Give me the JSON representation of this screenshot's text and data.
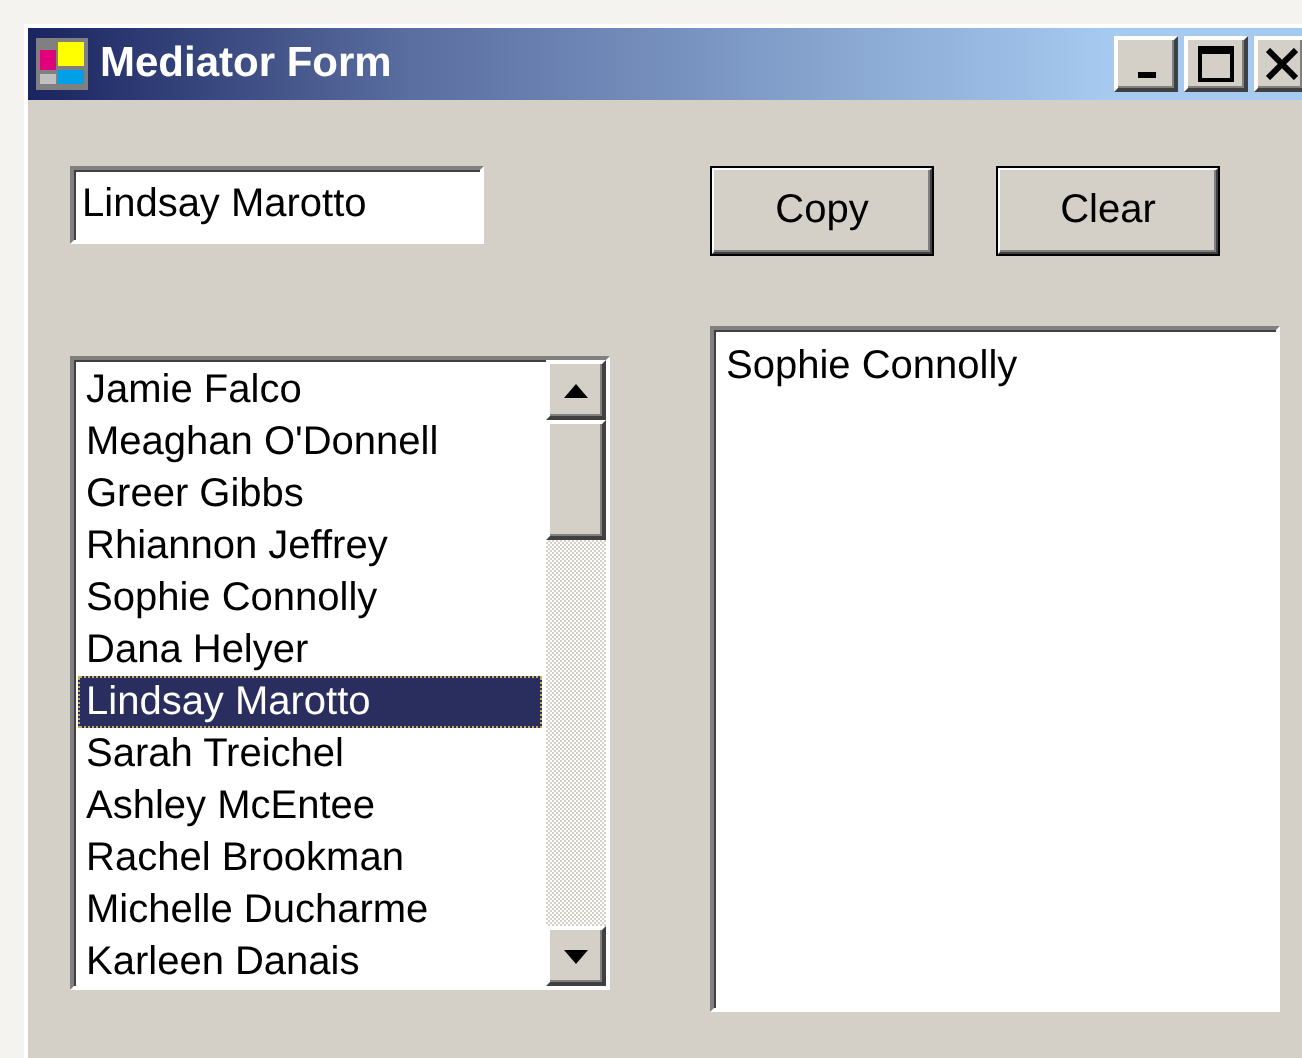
{
  "window": {
    "title": "Mediator Form"
  },
  "name_field": {
    "value": "Lindsay Marotto"
  },
  "buttons": [
    "Copy",
    "Clear"
  ],
  "name_list": {
    "items": [
      {
        "label": "Jamie Falco",
        "selected": false
      },
      {
        "label": "Meaghan O'Donnell",
        "selected": false
      },
      {
        "label": "Greer Gibbs",
        "selected": false
      },
      {
        "label": "Rhiannon Jeffrey",
        "selected": false
      },
      {
        "label": "Sophie Connolly",
        "selected": false
      },
      {
        "label": "Dana Helyer",
        "selected": false
      },
      {
        "label": "Lindsay Marotto",
        "selected": true
      },
      {
        "label": "Sarah Treichel",
        "selected": false
      },
      {
        "label": "Ashley McEntee",
        "selected": false
      },
      {
        "label": "Rachel Brookman",
        "selected": false
      },
      {
        "label": "Michelle Ducharme",
        "selected": false
      },
      {
        "label": "Karleen Danais",
        "selected": false
      }
    ]
  },
  "output_list": {
    "items": [
      "Sophie Connolly"
    ]
  }
}
